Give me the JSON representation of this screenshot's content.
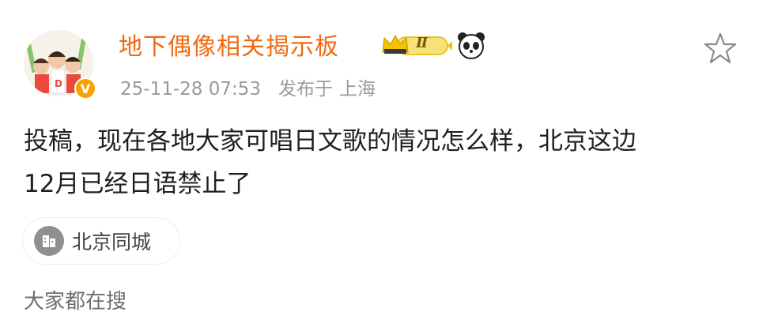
{
  "post": {
    "author": {
      "name": "地下偶像相关揭示板",
      "rank_label": "Ⅱ",
      "verified_mark": "V"
    },
    "meta": {
      "timestamp": "25-11-28 07:53",
      "location_label": "发布于",
      "location": "上海"
    },
    "text_line1": "投稿，现在各地大家可唱日文歌的情况怎么样，北京这边",
    "text_line2": "12月已经日语禁止了",
    "location_tag": "北京同城"
  },
  "search_section": {
    "title": "大家都在搜"
  },
  "colors": {
    "username": "#ef6a12",
    "meta": "#9a9a9a",
    "text": "#1f1f1f",
    "verified_badge": "#f5a300",
    "rank_badge": "#f3c200"
  },
  "icons": [
    "avatar",
    "verified-badge",
    "crown-rank-badge",
    "panda-icon",
    "star-icon",
    "building-icon"
  ]
}
